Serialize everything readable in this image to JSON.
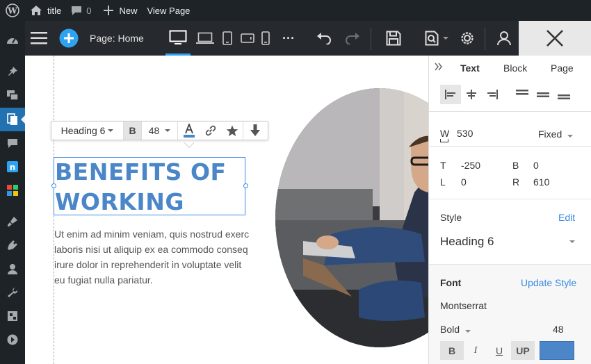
{
  "adminbar": {
    "site_title": "title",
    "comments_count": "0",
    "new_label": "New",
    "view_page_label": "View Page"
  },
  "toolbar": {
    "page_label": "Page: Home",
    "more_label": "···"
  },
  "format_bar": {
    "style": "Heading 6",
    "bold": "B",
    "font_size": "48"
  },
  "canvas": {
    "heading_line1": "BENEFITS OF",
    "heading_line2": "WORKING",
    "paragraph_lines": [
      "Ut enim ad minim veniam, quis nostrud exerc",
      "laboris nisi ut aliquip ex ea commodo conseq",
      "irure dolor in reprehenderit in voluptate velit",
      "eu fugiat nulla pariatur."
    ]
  },
  "panel": {
    "tabs": [
      "Text",
      "Block",
      "Page"
    ],
    "active_tab": "Text",
    "width_label": "W",
    "width_value": "530",
    "width_mode": "Fixed",
    "top_label": "T",
    "top_value": "-250",
    "bottom_label": "B",
    "bottom_value": "0",
    "left_label": "L",
    "left_value": "0",
    "right_label": "R",
    "right_value": "610",
    "style_label": "Style",
    "style_edit": "Edit",
    "style_value": "Heading 6",
    "font_label": "Font",
    "update_style": "Update Style",
    "font_family": "Montserrat",
    "font_weight": "Bold",
    "font_size": "48",
    "bold_btn": "B",
    "italic_btn": "I",
    "underline_btn": "U",
    "uppercase_btn": "UP"
  },
  "colors": {
    "accent": "#2ea3f2",
    "heading": "#4a86c8",
    "link": "#3a8ae0",
    "text_color_swatch": "#4a86c8"
  }
}
